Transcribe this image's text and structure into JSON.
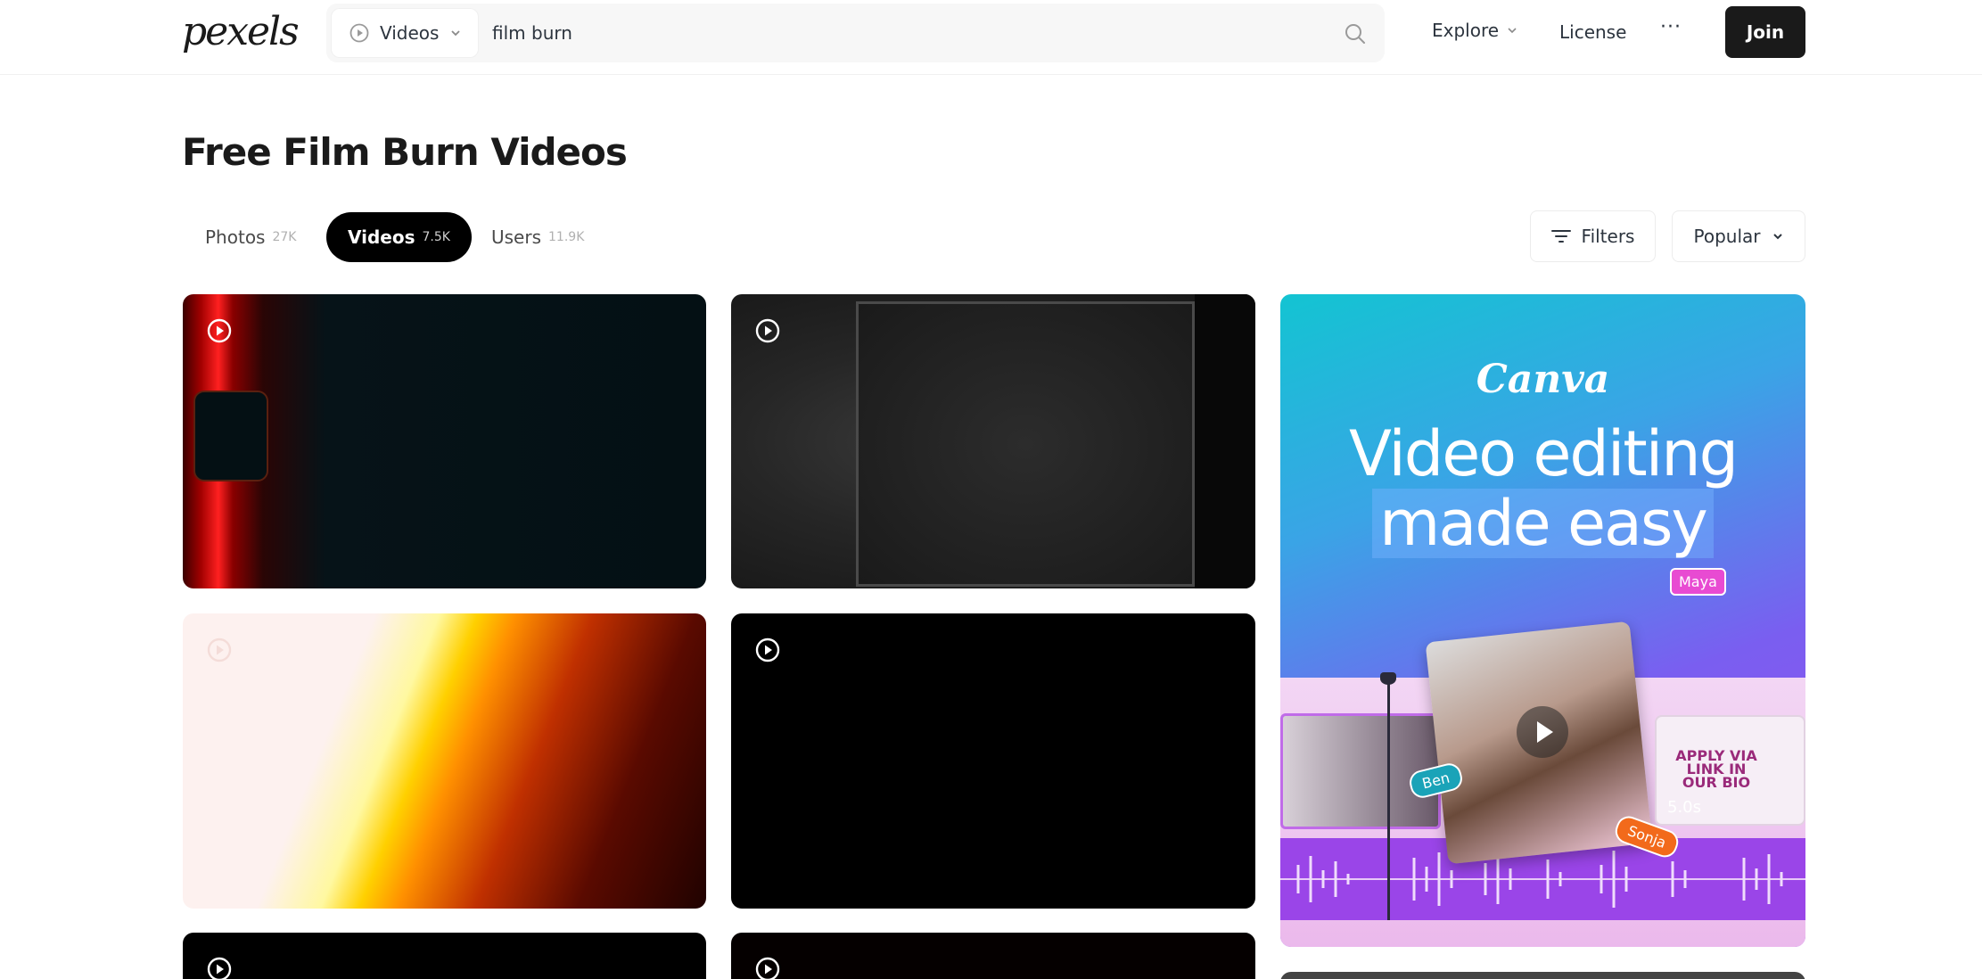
{
  "header": {
    "logo": "pexels",
    "search": {
      "type_label": "Videos",
      "query": "film burn",
      "placeholder": ""
    },
    "nav": {
      "explore": "Explore",
      "license": "License",
      "more": "···",
      "join": "Join"
    }
  },
  "page": {
    "title": "Free Film Burn Videos"
  },
  "tabs": [
    {
      "label": "Photos",
      "count": "27K"
    },
    {
      "label": "Videos",
      "count": "7.5K"
    },
    {
      "label": "Users",
      "count": "11.9K"
    }
  ],
  "controls": {
    "filters": "Filters",
    "sort": "Popular"
  },
  "ad": {
    "brand": "Canva",
    "headline_line1": "Video editing",
    "headline_line2": "made easy",
    "tag_maya": "Maya",
    "tag_ben": "Ben",
    "tag_sonja": "Sonja",
    "card_text": "APPLY VIA LINK IN OUR BIO",
    "duration": "5.0s"
  },
  "colors": {
    "accent": "#000000",
    "join_bg": "#1a1a1a",
    "ad_gradient_start": "#13c4d2",
    "ad_gradient_end": "#9b4ff0"
  }
}
